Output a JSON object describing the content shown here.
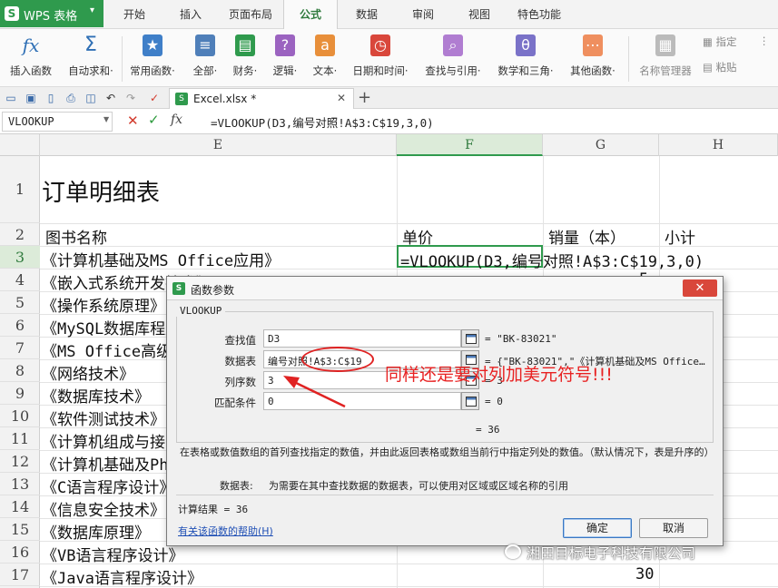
{
  "app": {
    "name": "WPS 表格",
    "logo": "S",
    "brand_color": "#2f9a4d"
  },
  "menu": {
    "tabs": [
      "开始",
      "插入",
      "页面布局",
      "公式",
      "数据",
      "审阅",
      "视图",
      "特色功能"
    ],
    "active_tab": "公式"
  },
  "ribbon": {
    "buttons": [
      {
        "label": "插入函数",
        "icon": "fx-icon"
      },
      {
        "label": "自动求和·",
        "icon": "sigma-icon"
      },
      {
        "label": "常用函数·",
        "icon": "star-book-icon"
      },
      {
        "label": "全部·",
        "icon": "list-book-icon"
      },
      {
        "label": "财务·",
        "icon": "finance-book-icon"
      },
      {
        "label": "逻辑·",
        "icon": "logic-book-icon"
      },
      {
        "label": "文本·",
        "icon": "text-book-icon"
      },
      {
        "label": "日期和时间·",
        "icon": "clock-book-icon"
      },
      {
        "label": "查找与引用·",
        "icon": "search-book-icon"
      },
      {
        "label": "数学和三角·",
        "icon": "theta-book-icon"
      },
      {
        "label": "其他函数·",
        "icon": "more-book-icon"
      }
    ],
    "name_manager": "名称管理器",
    "specify": "指定",
    "paste": "粘贴"
  },
  "document_tab": {
    "name": "Excel.xlsx *"
  },
  "formula_bar": {
    "name_box": "VLOOKUP",
    "cancel_symbol": "✕",
    "confirm_symbol": "✓",
    "fx_symbol": "fx",
    "formula": "=VLOOKUP(D3,编号对照!A$3:C$19,3,0)"
  },
  "grid": {
    "columns": [
      "E",
      "F",
      "G",
      "H"
    ],
    "selected_column": "F",
    "rows": [
      "1",
      "2",
      "3",
      "4",
      "5",
      "6",
      "7",
      "8",
      "9",
      "10",
      "11",
      "12",
      "13",
      "14",
      "15",
      "16",
      "17"
    ],
    "selected_row": "3",
    "title": "订单明细表",
    "headers": {
      "E": "图书名称",
      "F": "单价",
      "G": "销量（本）",
      "H": "小计"
    },
    "book_names": [
      "《计算机基础及MS Office应用》",
      "《嵌入式系统开发技术》",
      "《操作系统原理》",
      "《MySQL数据库程序设计》",
      "《MS Office高级应用》",
      "《网络技术》",
      "《数据库技术》",
      "《软件测试技术》",
      "《计算机组成与接口》",
      "《计算机基础及Photoshop应用》",
      "《C语言程序设计》",
      "《信息安全技术》",
      "《数据库原理》",
      "《VB语言程序设计》",
      "《Java语言程序设计》"
    ],
    "active_cell_text": "=VLOOKUP(D3,编号对照!A$3:C$19,3,0)",
    "g_visible_values": {
      "row4": "5",
      "row17": "30"
    }
  },
  "dialog": {
    "title": "函数参数",
    "function_name": "VLOOKUP",
    "args": [
      {
        "label": "查找值",
        "value": "D3",
        "result": "= \"BK-83021\""
      },
      {
        "label": "数据表",
        "value": "编号对照!A$3:C$19",
        "result": "= {\"BK-83021\",\"《计算机基础及MS Office…"
      },
      {
        "label": "列序数",
        "value": "3",
        "result": "= 3"
      },
      {
        "label": "匹配条件",
        "value": "0",
        "result": "= 0"
      }
    ],
    "overall_result": "= 36",
    "description": "在表格或数值数组的首列查找指定的数值，并由此返回表格或数组当前行中指定列处的数值。（默认情况下，表是升序的）",
    "param_name": "数据表:",
    "param_description": "为需要在其中查找数据的数据表，可以使用对区域或区域名称的引用",
    "calc_result": "计算结果 = 36",
    "help_link": "有关该函数的帮助(H)",
    "ok_label": "确定",
    "cancel_label": "取消",
    "close_symbol": "✕"
  },
  "annotation": {
    "text": "同样还是要对列加美元符号!!!",
    "color": "#e82222"
  },
  "watermark": {
    "text": "湘田目标电子科技有限公司"
  }
}
